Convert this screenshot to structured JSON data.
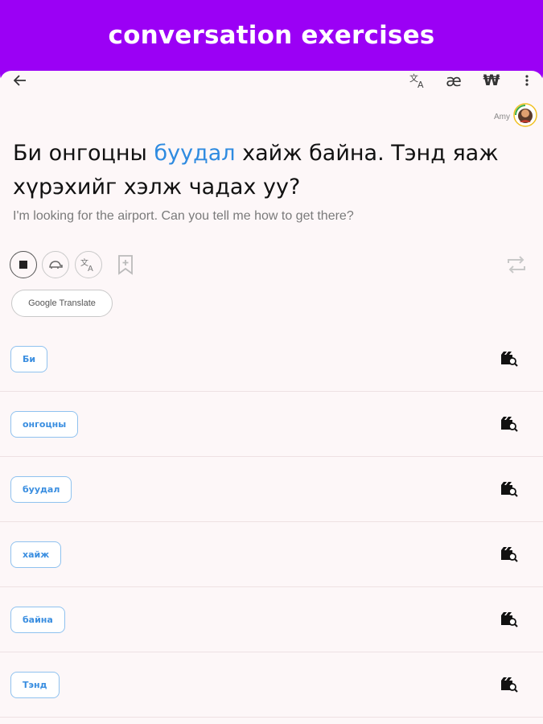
{
  "banner": {
    "title": "conversation exercises",
    "color": "#9b00f5"
  },
  "appbar": {
    "back": "back-arrow-icon",
    "translate": "translate-icon",
    "phonetic_label": "æ",
    "currency_label": "₩",
    "more": "more-vertical-icon"
  },
  "speaker": {
    "name": "Amy"
  },
  "sentence": {
    "before": "Би онгоцны ",
    "highlight": "буудал",
    "after": " хайж байна. Тэнд яаж хүрэхийг хэлж чадах уу?",
    "translation": "I'm looking for the airport. Can you tell me how to get there?",
    "highlight_color": "#2f8be0"
  },
  "controls": {
    "stop": "stop-icon",
    "slow": "turtle-icon",
    "translate": "translate-icon",
    "bookmark": "bookmark-add-icon",
    "repeat": "repeat-icon",
    "google_translate_label": "Google Translate"
  },
  "words": [
    {
      "text": "Би"
    },
    {
      "text": "онгоцны"
    },
    {
      "text": "буудал"
    },
    {
      "text": "хайж"
    },
    {
      "text": "байна"
    },
    {
      "text": "Тэнд"
    }
  ]
}
